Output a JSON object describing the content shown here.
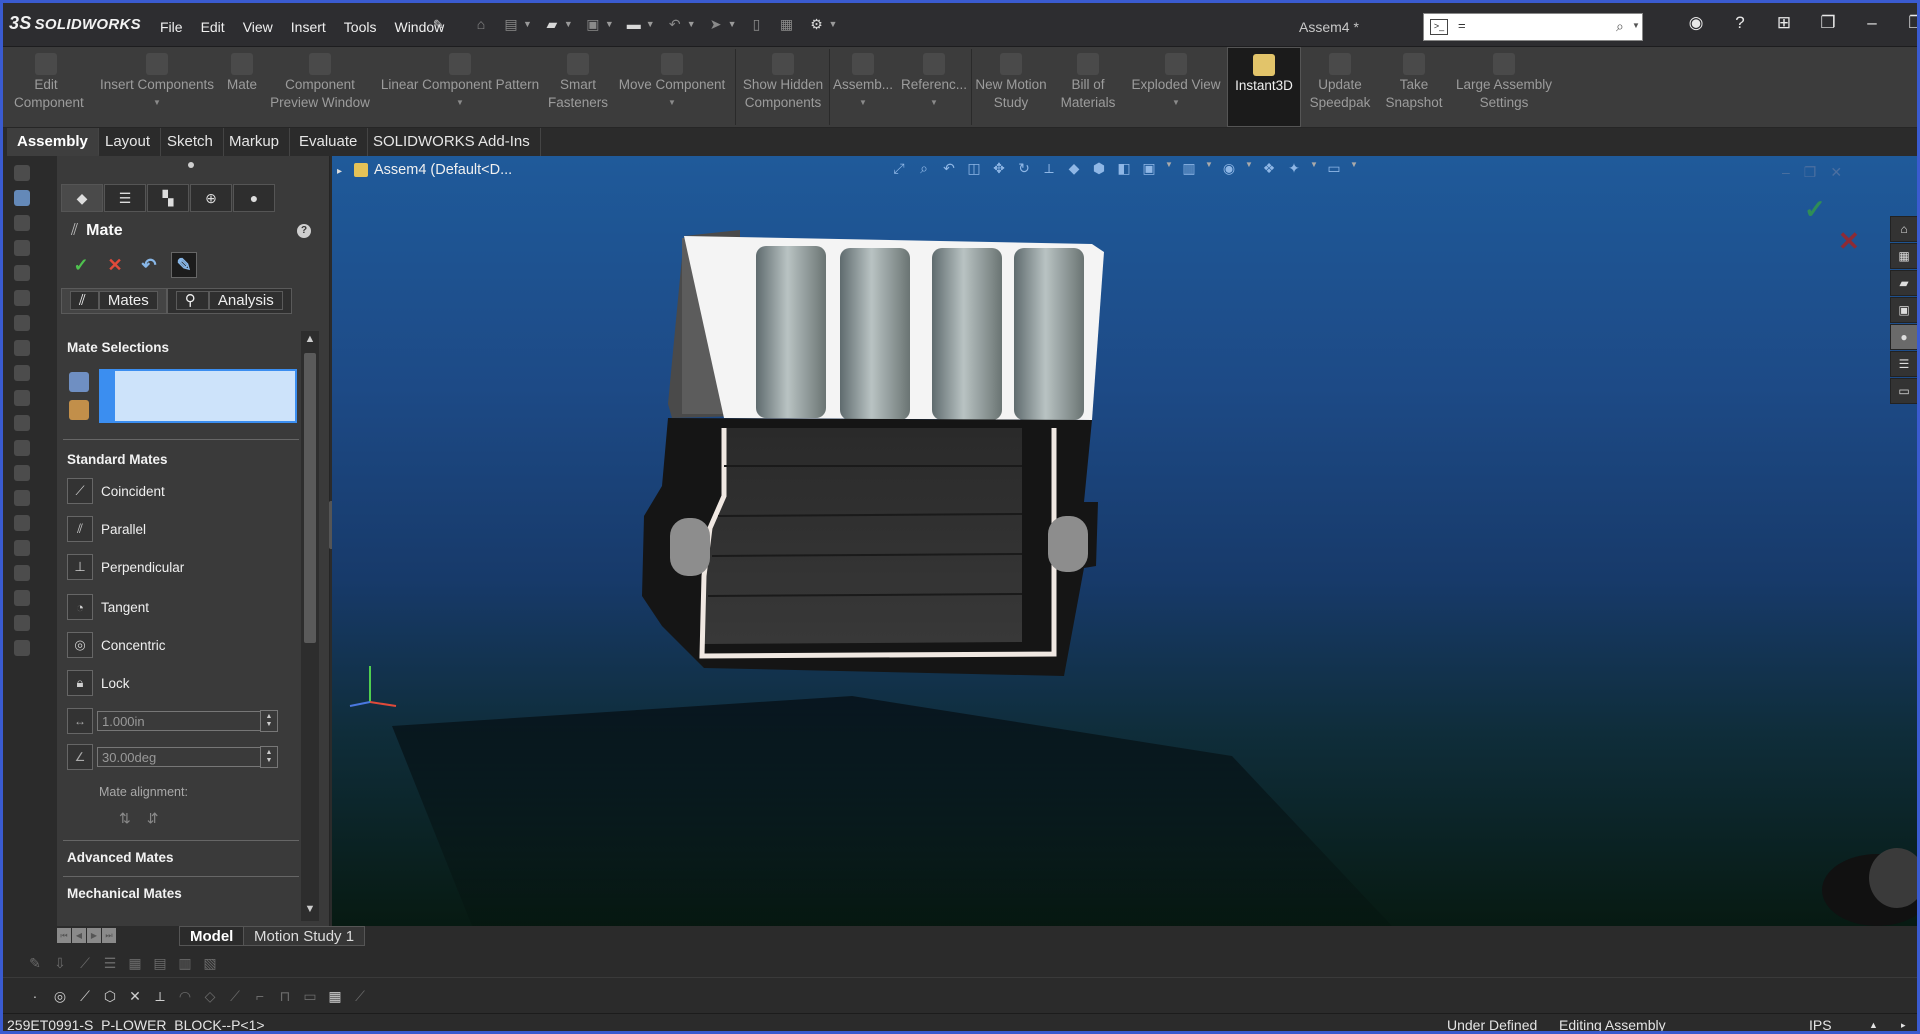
{
  "app": {
    "brand": "SOLIDWORKS",
    "document_title": "Assem4 *",
    "menu": [
      "File",
      "Edit",
      "View",
      "Insert",
      "Tools",
      "Window"
    ],
    "search": {
      "value": "=",
      "placeholder": ""
    }
  },
  "command_manager": {
    "items": [
      {
        "label": "Edit Component",
        "icon": "edit-component-icon"
      },
      {
        "label": "Insert Components",
        "icon": "insert-components-icon"
      },
      {
        "label": "Mate",
        "icon": "mate-icon"
      },
      {
        "label": "Component Preview Window",
        "icon": "preview-window-icon"
      },
      {
        "label": "Linear Component Pattern",
        "icon": "linear-pattern-icon"
      },
      {
        "label": "Smart Fasteners",
        "icon": "smart-fasteners-icon"
      },
      {
        "label": "Move Component",
        "icon": "move-component-icon"
      },
      {
        "label": "Show Hidden Components",
        "icon": "show-hidden-icon"
      },
      {
        "label": "Assemb...",
        "icon": "assembly-features-icon"
      },
      {
        "label": "Referenc...",
        "icon": "reference-geometry-icon"
      },
      {
        "label": "New Motion Study",
        "icon": "motion-study-icon"
      },
      {
        "label": "Bill of Materials",
        "icon": "bom-icon"
      },
      {
        "label": "Exploded View",
        "icon": "exploded-view-icon"
      },
      {
        "label": "Instant3D",
        "icon": "instant3d-icon"
      },
      {
        "label": "Update Speedpak",
        "icon": "speedpak-icon"
      },
      {
        "label": "Take Snapshot",
        "icon": "snapshot-icon"
      },
      {
        "label": "Large Assembly Settings",
        "icon": "large-assembly-icon"
      }
    ]
  },
  "tabs": [
    "Assembly",
    "Layout",
    "Sketch",
    "Markup",
    "Evaluate",
    "SOLIDWORKS Add-Ins"
  ],
  "property_manager": {
    "title": "Mate",
    "subtabs": [
      "Mates",
      "Analysis"
    ],
    "mate_selections_header": "Mate Selections",
    "standard_mates_header": "Standard Mates",
    "standard_mates": [
      "Coincident",
      "Parallel",
      "Perpendicular",
      "Tangent",
      "Concentric",
      "Lock"
    ],
    "distance_value": "1.000in",
    "angle_value": "30.00deg",
    "mate_alignment_label": "Mate alignment:",
    "advanced_mates_header": "Advanced Mates",
    "mechanical_mates_header": "Mechanical Mates"
  },
  "viewport": {
    "tree_root": "Assem4  (Default<D..."
  },
  "bottom_tabs": [
    "Model",
    "Motion Study 1"
  ],
  "status": {
    "component": "259ET0991-S_P-LOWER_BLOCK--P<1>",
    "definition": "Under Defined",
    "mode": "Editing Assembly",
    "units": "IPS"
  },
  "colors": {
    "accent": "#3b8ef0",
    "selection_fill": "#cde3fa",
    "ok": "#4fc24f",
    "cancel": "#e04a3a"
  }
}
